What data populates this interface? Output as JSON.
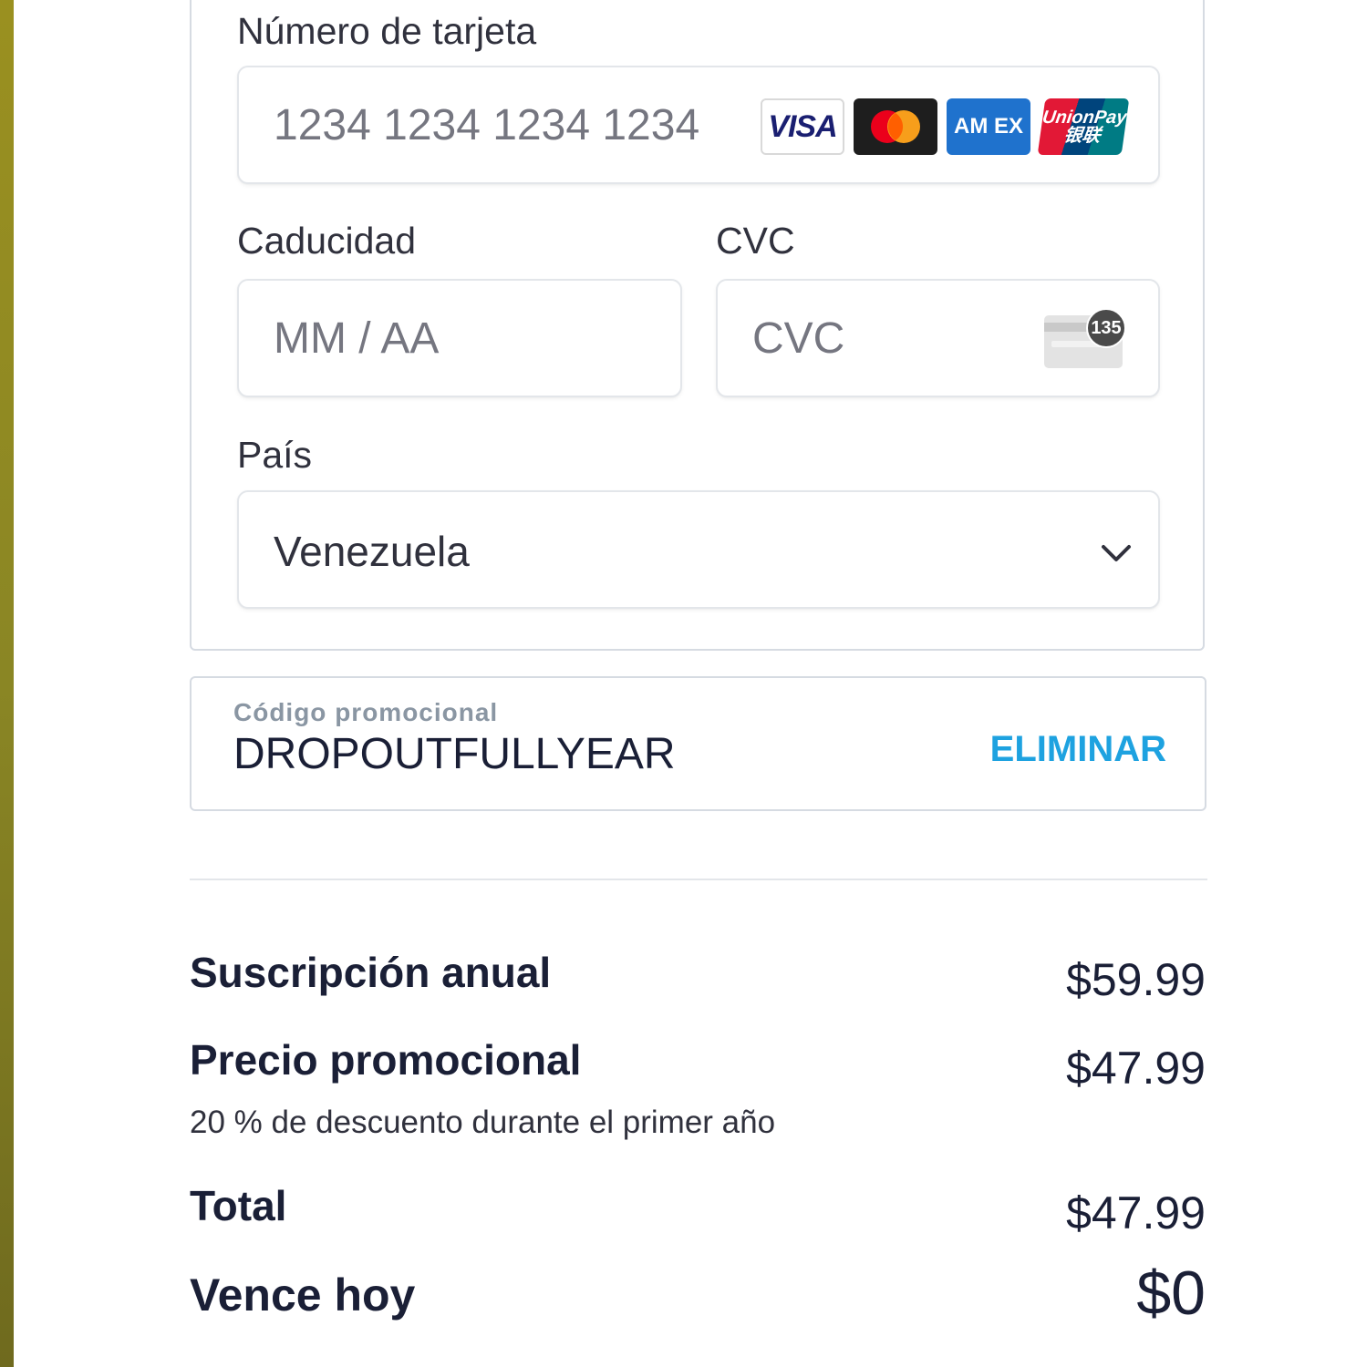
{
  "payment_form": {
    "card_number": {
      "label": "Número de tarjeta",
      "placeholder": "1234 1234 1234 1234",
      "brands": [
        "visa-icon",
        "mastercard-icon",
        "amex-icon",
        "unionpay-icon"
      ],
      "brand_texts": {
        "visa": "VISA",
        "amex": "AM EX",
        "unionpay": "UnionPay 银联"
      }
    },
    "expiry": {
      "label": "Caducidad",
      "placeholder": "MM / AA"
    },
    "cvc": {
      "label": "CVC",
      "placeholder": "CVC",
      "hint_number": "135"
    },
    "country": {
      "label": "País",
      "value": "Venezuela"
    }
  },
  "promo": {
    "label": "Código promocional",
    "code": "DROPOUTFULLYEAR",
    "remove_label": "ELIMINAR"
  },
  "summary": {
    "annual": {
      "label": "Suscripción anual",
      "value": "$59.99"
    },
    "promo_price": {
      "label": "Precio promocional",
      "value": "$47.99",
      "note": "20 % de descuento durante el primer año"
    },
    "total": {
      "label": "Total",
      "value": "$47.99"
    },
    "due_today": {
      "label": "Vence hoy",
      "value": "$0"
    }
  },
  "colors": {
    "accent": "#1ea2e0",
    "text": "#1a1f36",
    "border": "#d6dbe2"
  }
}
